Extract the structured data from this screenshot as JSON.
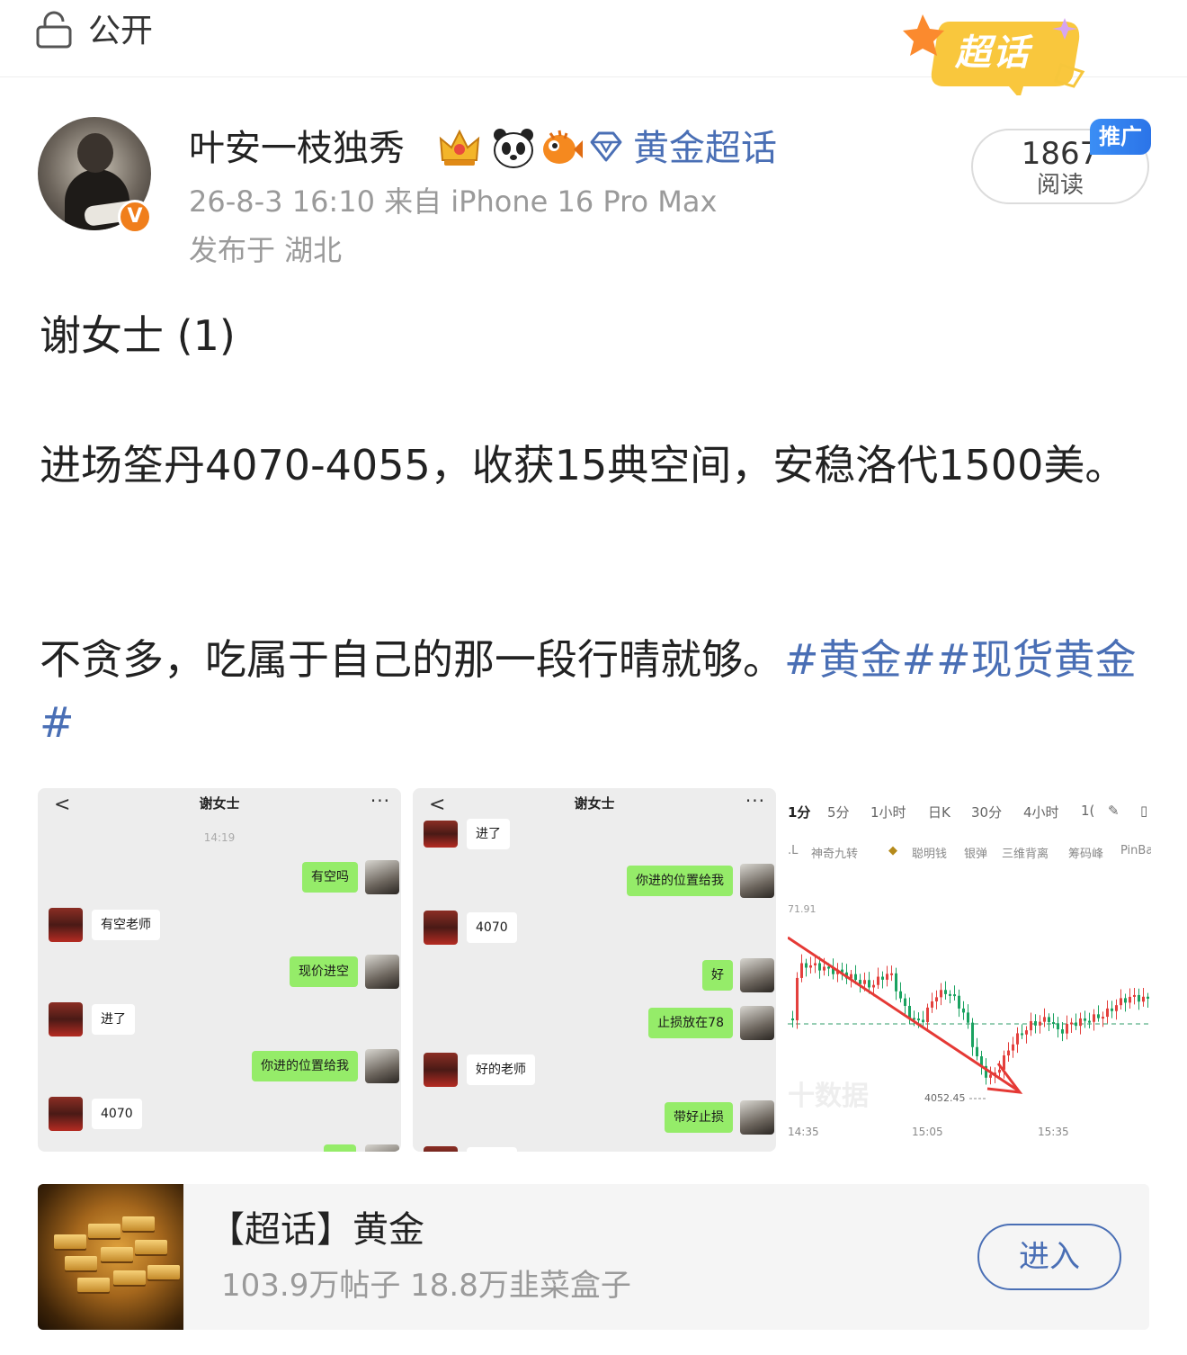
{
  "header": {
    "visibility": "公开",
    "lock_icon": "lock-icon",
    "supertopic_badge": "超话"
  },
  "author": {
    "name": "叶安一枝独秀",
    "verified_mark": "V",
    "badges": [
      "crown-icon",
      "panda-icon",
      "pufferfish-icon",
      "diamond-icon"
    ],
    "supertopic_link": "黄金超话",
    "time_source": "26-8-3 16:10  来自 iPhone 16 Pro Max",
    "location": "发布于 湖北"
  },
  "reads": {
    "count": "1867",
    "label": "阅读",
    "promo_tag": "推广"
  },
  "post": {
    "line1": "谢女士 (1)",
    "line2": "进场筌丹4070-4055，收获15典空间，安稳洛代1500美。",
    "line3_text": "不贪多，吃属于自己的那一段行晴就够。",
    "hashtag1": "#黄金#",
    "hashtag2": "#现货黄金#"
  },
  "chat1": {
    "back": "<",
    "title": "谢女士",
    "more": "···",
    "time": "14:19",
    "messages": [
      {
        "from": "me",
        "text": "有空吗"
      },
      {
        "from": "them",
        "text": "有空老师"
      },
      {
        "from": "me",
        "text": "现价进空"
      },
      {
        "from": "them",
        "text": "进了"
      },
      {
        "from": "me",
        "text": "你进的位置给我"
      },
      {
        "from": "them",
        "text": "4070"
      }
    ]
  },
  "chat2": {
    "back": "<",
    "title": "谢女士",
    "more": "···",
    "messages": [
      {
        "from": "them",
        "text": "进了"
      },
      {
        "from": "me",
        "text": "你进的位置给我"
      },
      {
        "from": "them",
        "text": "4070"
      },
      {
        "from": "me",
        "text": "好"
      },
      {
        "from": "me",
        "text": "止损放在78"
      },
      {
        "from": "them",
        "text": "好的老师"
      },
      {
        "from": "me",
        "text": "带好止损"
      }
    ]
  },
  "chart_tile": {
    "timeframes": [
      "1分",
      "5分",
      "1小时",
      "日K",
      "30分",
      "4小时",
      "1("
    ],
    "indicators": [
      "神奇九转",
      "聪明钱",
      "银弹",
      "三维背离",
      "筹码峰",
      "PinBa"
    ],
    "watermark": "十数据"
  },
  "chart_data": {
    "type": "candlestick",
    "x_ticks": [
      "14:35",
      "15:05",
      "15:35"
    ],
    "y_labels": [
      "71.91"
    ],
    "low_label": "4052.45",
    "trend_arrow": "down",
    "colors": {
      "up": "#e3403d",
      "down": "#1aa260",
      "arrow": "#e53935"
    }
  },
  "topic_card": {
    "title": "【超话】黄金",
    "stats": "103.9万帖子 18.8万韭菜盒子",
    "enter": "进入"
  }
}
